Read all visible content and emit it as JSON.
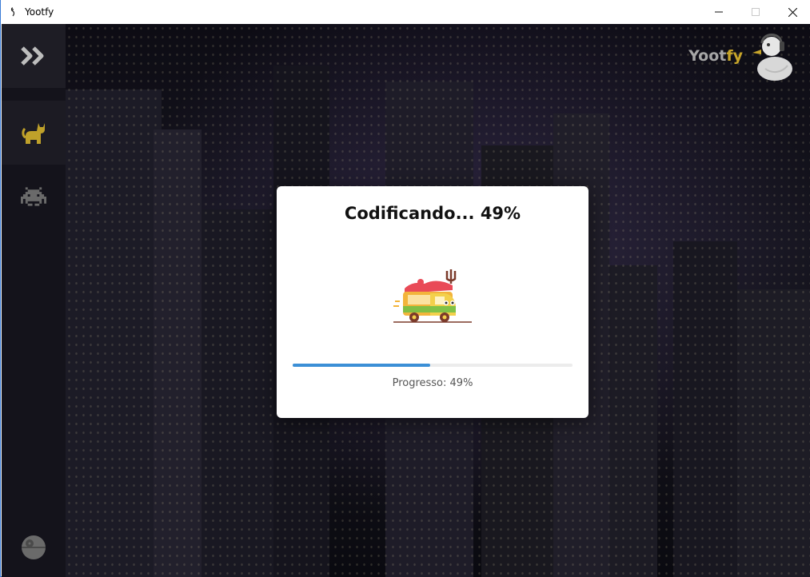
{
  "window": {
    "title": "Yootfy",
    "minimize_icon": "minimize-icon",
    "maximize_icon": "maximize-icon",
    "close_icon": "close-icon"
  },
  "sidebar": {
    "items": [
      {
        "icon": "double-chevron-right-icon",
        "color": "#bdbdbd"
      },
      {
        "icon": "cat-icon",
        "color": "#bfa12a",
        "active": true
      },
      {
        "icon": "space-invader-icon",
        "color": "#6a6a6a"
      },
      {
        "icon": "death-star-icon",
        "color": "#6a6a6a"
      }
    ]
  },
  "logo": {
    "text_a": "Yoot",
    "text_b": "fy",
    "icon": "duck-headphones-icon"
  },
  "dialog": {
    "title": "Codificando... 49%",
    "illustration": "food-truck-icon",
    "progress": 0.49,
    "progress_text": "Progresso: 49%",
    "accent": "#3b8fd6"
  }
}
